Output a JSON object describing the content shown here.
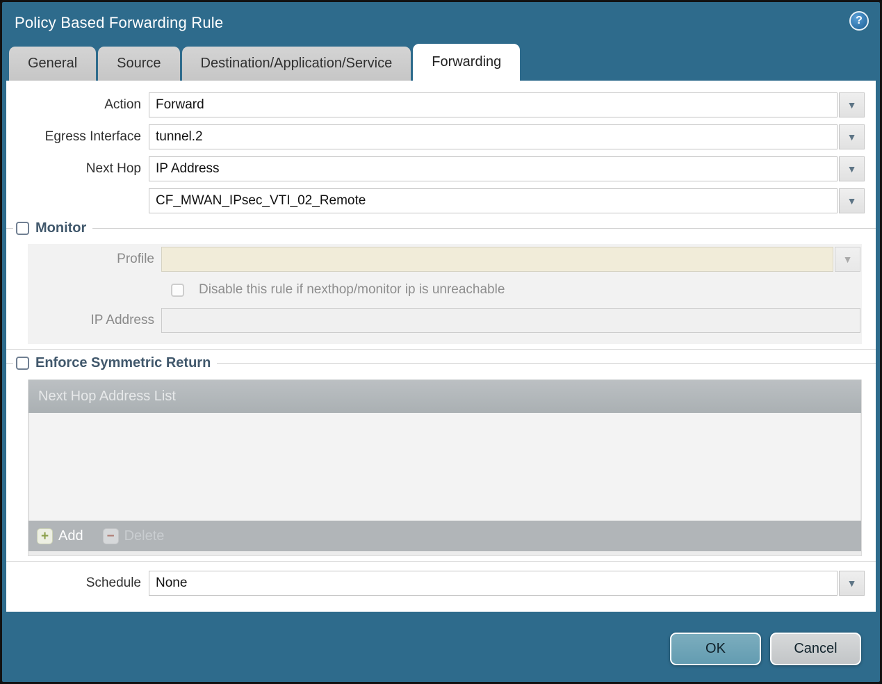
{
  "window": {
    "title": "Policy Based Forwarding Rule"
  },
  "icons": {
    "help": "?",
    "dropdown": "▼",
    "add": "+",
    "delete": "−"
  },
  "tabs": [
    {
      "label": "General",
      "active": false
    },
    {
      "label": "Source",
      "active": false
    },
    {
      "label": "Destination/Application/Service",
      "active": false
    },
    {
      "label": "Forwarding",
      "active": true
    }
  ],
  "form": {
    "action": {
      "label": "Action",
      "value": "Forward"
    },
    "egress_interface": {
      "label": "Egress Interface",
      "value": "tunnel.2"
    },
    "next_hop": {
      "label": "Next Hop",
      "value": "IP Address"
    },
    "next_hop_address": {
      "value": "CF_MWAN_IPsec_VTI_02_Remote"
    },
    "monitor": {
      "legend": "Monitor",
      "checked": false,
      "profile": {
        "label": "Profile",
        "value": ""
      },
      "disable_rule_label": "Disable this rule if nexthop/monitor ip is unreachable",
      "disable_rule_checked": false,
      "ip_address": {
        "label": "IP Address",
        "value": ""
      }
    },
    "symmetric_return": {
      "legend": "Enforce Symmetric Return",
      "checked": false,
      "table": {
        "header": "Next Hop Address List",
        "rows": []
      },
      "add_label": "Add",
      "delete_label": "Delete"
    },
    "schedule": {
      "label": "Schedule",
      "value": "None"
    }
  },
  "footer": {
    "ok_label": "OK",
    "cancel_label": "Cancel"
  },
  "colors": {
    "titlebar_teal": "#2e6b8c",
    "ok_button_teal": "#6da4b8",
    "table_header_gray": "#b1b5b8",
    "profile_field_beige": "#f1ecd9",
    "legend_text": "#41586c"
  }
}
